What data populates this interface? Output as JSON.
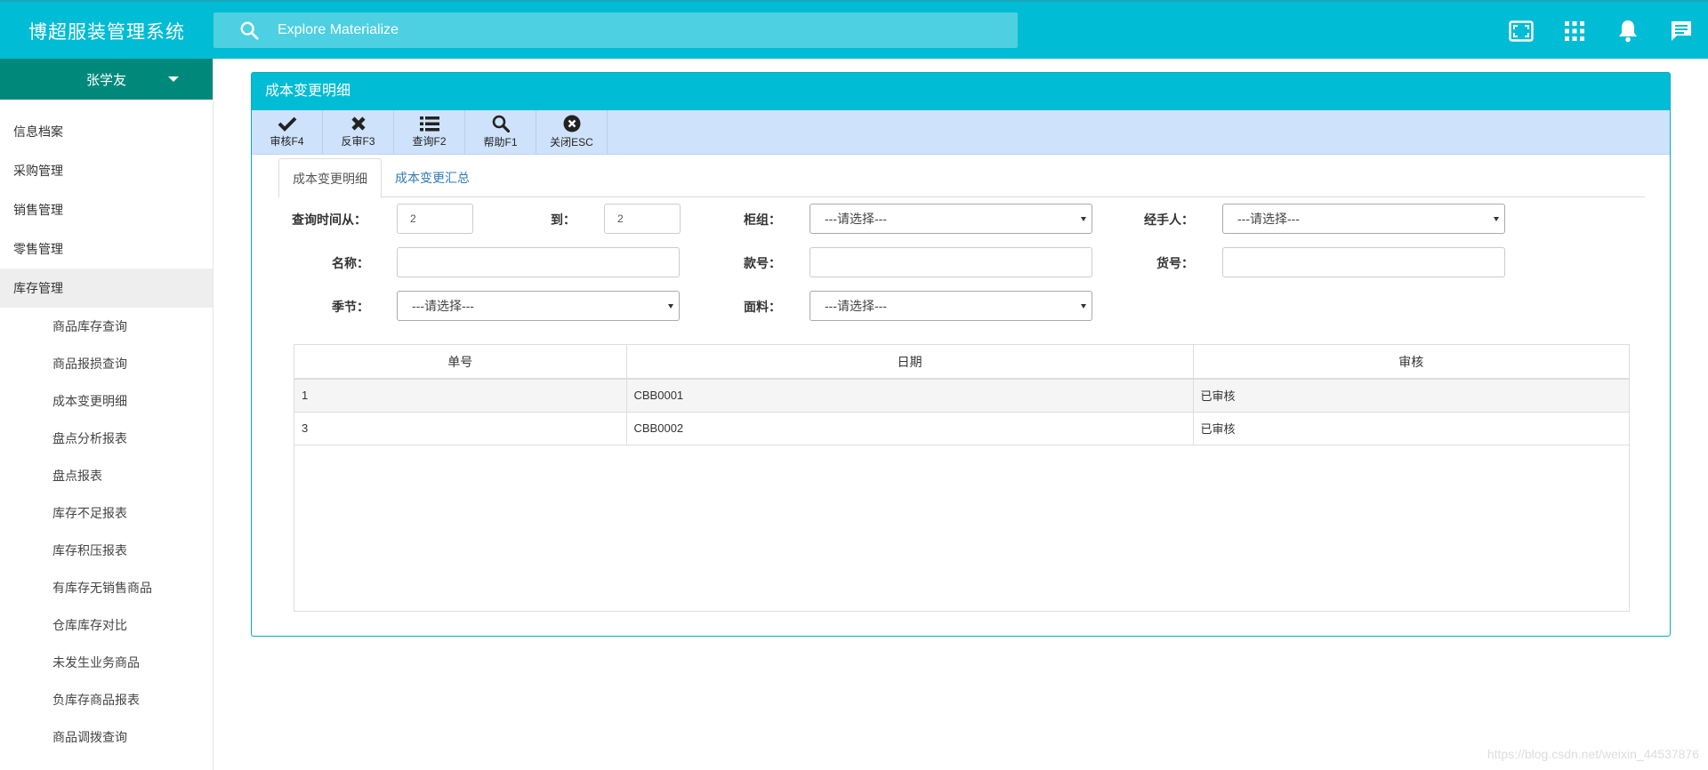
{
  "app": {
    "title": "博超服装管理系统"
  },
  "search": {
    "placeholder": "Explore Materialize"
  },
  "header_icons": [
    "fullscreen-icon",
    "apps-grid-icon",
    "notifications-bell-icon",
    "chat-message-icon"
  ],
  "user": {
    "name": "张学友"
  },
  "sidebar": {
    "items": [
      {
        "label": "信息档案"
      },
      {
        "label": "采购管理"
      },
      {
        "label": "销售管理"
      },
      {
        "label": "零售管理"
      },
      {
        "label": "库存管理"
      }
    ],
    "sub_items": [
      {
        "label": "商品库存查询"
      },
      {
        "label": "商品报损查询"
      },
      {
        "label": "成本变更明细"
      },
      {
        "label": "盘点分析报表"
      },
      {
        "label": "盘点报表"
      },
      {
        "label": "库存不足报表"
      },
      {
        "label": "库存积压报表"
      },
      {
        "label": "有库存无销售商品"
      },
      {
        "label": "仓库库存对比"
      },
      {
        "label": "未发生业务商品"
      },
      {
        "label": "负库存商品报表"
      },
      {
        "label": "商品调拨查询"
      }
    ]
  },
  "panel": {
    "title": "成本变更明细"
  },
  "toolbar": {
    "approve": "审核F4",
    "unapprove": "反审F3",
    "query": "查询F2",
    "help": "帮助F1",
    "close": "关闭ESC"
  },
  "tabs": {
    "detail": "成本变更明细",
    "summary": "成本变更汇总"
  },
  "form": {
    "date_from_label": "查询时间从：",
    "date_to_label": "到：",
    "date_from_value": "2",
    "date_to_value": "2",
    "counter_label": "柜组：",
    "counter_value": "---请选择---",
    "handler_label": "经手人：",
    "handler_value": "---请选择---",
    "name_label": "名称：",
    "style_label": "款号：",
    "item_label": "货号：",
    "season_label": "季节：",
    "season_value": "---请选择---",
    "fabric_label": "面料：",
    "fabric_value": "---请选择---"
  },
  "table": {
    "headers": [
      "单号",
      "日期",
      "审核"
    ],
    "rows": [
      [
        "1",
        "CBB0001",
        "已审核"
      ],
      [
        "3",
        "CBB0002",
        "已审核"
      ]
    ]
  },
  "watermark": "https://blog.csdn.net/weixin_44537876",
  "colors": {
    "primary": "#00bcd4",
    "user_bar": "#00897b",
    "toolbar": "#cfe2fb"
  }
}
